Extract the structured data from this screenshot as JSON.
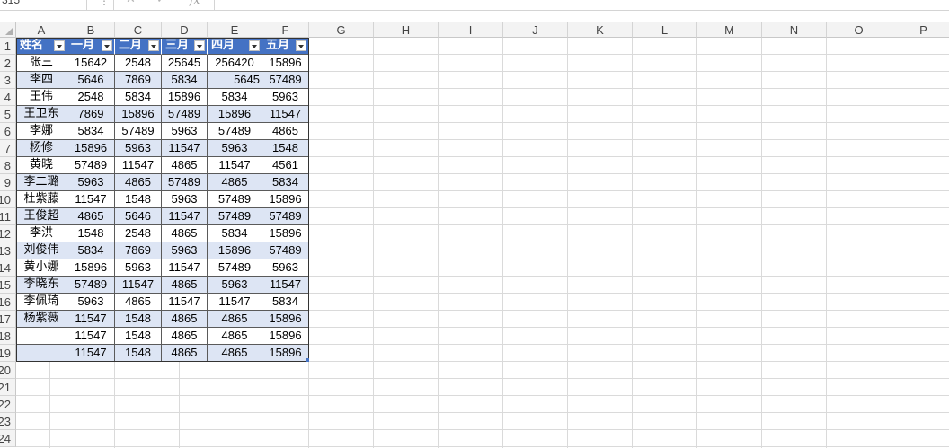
{
  "name_box": "315",
  "formula_bar": {
    "fx_label": "fx",
    "separator": "⋮",
    "cancel_glyph": "✕",
    "confirm_glyph": "✓"
  },
  "columns": [
    "A",
    "B",
    "C",
    "D",
    "E",
    "F",
    "G",
    "H",
    "I",
    "J",
    "K",
    "L",
    "M",
    "N",
    "O",
    "P"
  ],
  "row_numbers": [
    "1",
    "2",
    "3",
    "4",
    "5",
    "6",
    "7",
    "8",
    "9",
    "10",
    "11",
    "12",
    "13",
    "14",
    "15",
    "16",
    "17",
    "18",
    "19",
    "20",
    "21",
    "22",
    "23",
    "24"
  ],
  "table": {
    "headers": [
      "姓名",
      "一月",
      "二月",
      "三月",
      "四月",
      "五月"
    ],
    "rows": [
      [
        "张三",
        "15642",
        "2548",
        "25645",
        "256420",
        "15896"
      ],
      [
        "李四",
        "5646",
        "7869",
        "5834",
        "5645",
        "57489"
      ],
      [
        "王伟",
        "2548",
        "5834",
        "15896",
        "5834",
        "5963"
      ],
      [
        "王卫东",
        "7869",
        "15896",
        "57489",
        "15896",
        "11547"
      ],
      [
        "李娜",
        "5834",
        "57489",
        "5963",
        "57489",
        "4865"
      ],
      [
        "杨修",
        "15896",
        "5963",
        "11547",
        "5963",
        "1548"
      ],
      [
        "黄晓",
        "57489",
        "11547",
        "4865",
        "11547",
        "4561"
      ],
      [
        "李二璐",
        "5963",
        "4865",
        "57489",
        "4865",
        "5834"
      ],
      [
        "杜紫藤",
        "11547",
        "1548",
        "5963",
        "57489",
        "15896"
      ],
      [
        "王俊超",
        "4865",
        "5646",
        "11547",
        "57489",
        "57489"
      ],
      [
        "李洪",
        "1548",
        "2548",
        "4865",
        "5834",
        "15896"
      ],
      [
        "刘俊伟",
        "5834",
        "7869",
        "5963",
        "15896",
        "57489"
      ],
      [
        "黄小娜",
        "15896",
        "5963",
        "11547",
        "57489",
        "5963"
      ],
      [
        "李晓东",
        "57489",
        "11547",
        "4865",
        "5963",
        "11547"
      ],
      [
        "李佩琦",
        "5963",
        "4865",
        "11547",
        "11547",
        "5834"
      ],
      [
        "杨紫薇",
        "11547",
        "1548",
        "4865",
        "4865",
        "15896"
      ],
      [
        "",
        "11547",
        "1548",
        "4865",
        "4865",
        "15896"
      ],
      [
        "",
        "11547",
        "1548",
        "4865",
        "4865",
        "15896"
      ]
    ]
  },
  "colors": {
    "header_fill": "#4472c4",
    "band_fill": "#dde5f4",
    "header_text": "#ffffff"
  }
}
